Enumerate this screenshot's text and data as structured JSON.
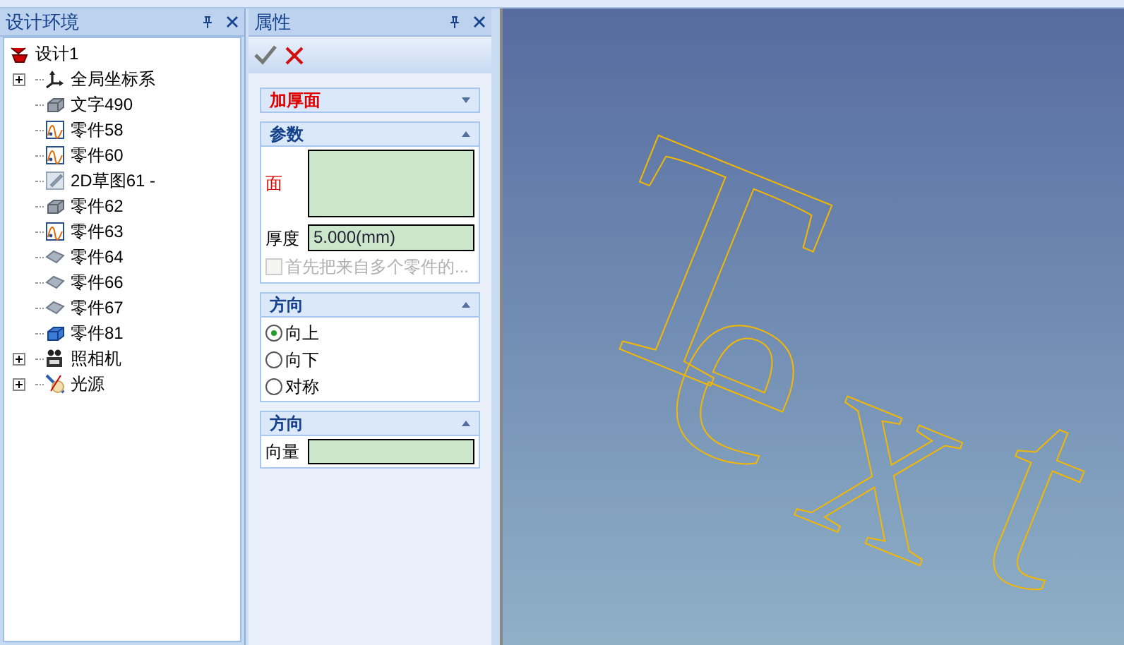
{
  "tree_panel": {
    "title": "设计环境",
    "root": {
      "label": "设计1",
      "kind": "design",
      "children": [
        {
          "label": "全局坐标系",
          "kind": "axes",
          "expanded": false
        },
        {
          "label": "文字490",
          "kind": "solid"
        },
        {
          "label": "零件58",
          "kind": "curve"
        },
        {
          "label": "零件60",
          "kind": "curve"
        },
        {
          "label": "2D草图61 -",
          "kind": "sketch"
        },
        {
          "label": "零件62",
          "kind": "solid"
        },
        {
          "label": "零件63",
          "kind": "curve"
        },
        {
          "label": "零件64",
          "kind": "surface"
        },
        {
          "label": "零件66",
          "kind": "surface"
        },
        {
          "label": "零件67",
          "kind": "surface"
        },
        {
          "label": "零件81",
          "kind": "solid_blue"
        },
        {
          "label": "照相机",
          "kind": "camera",
          "expanded": false
        },
        {
          "label": "光源",
          "kind": "light",
          "expanded": false
        }
      ]
    }
  },
  "property_panel": {
    "title": "属性",
    "feature": {
      "title": "加厚面",
      "expanded": false
    },
    "sections": [
      {
        "kind": "params",
        "title": "参数",
        "expanded": true,
        "face_label": "面",
        "thickness_label": "厚度",
        "thickness_value": "5.000(mm)",
        "option": {
          "label": "首先把来自多个零件的...",
          "checked": false,
          "disabled": true
        }
      },
      {
        "kind": "radios",
        "title": "方向",
        "expanded": true,
        "options": [
          {
            "label": "向上",
            "selected": true
          },
          {
            "label": "向下",
            "selected": false
          },
          {
            "label": "对称",
            "selected": false
          }
        ]
      },
      {
        "kind": "vector",
        "title": "方向",
        "expanded": true,
        "label": "向量"
      }
    ]
  },
  "viewport": {
    "model_text": "Text"
  }
}
